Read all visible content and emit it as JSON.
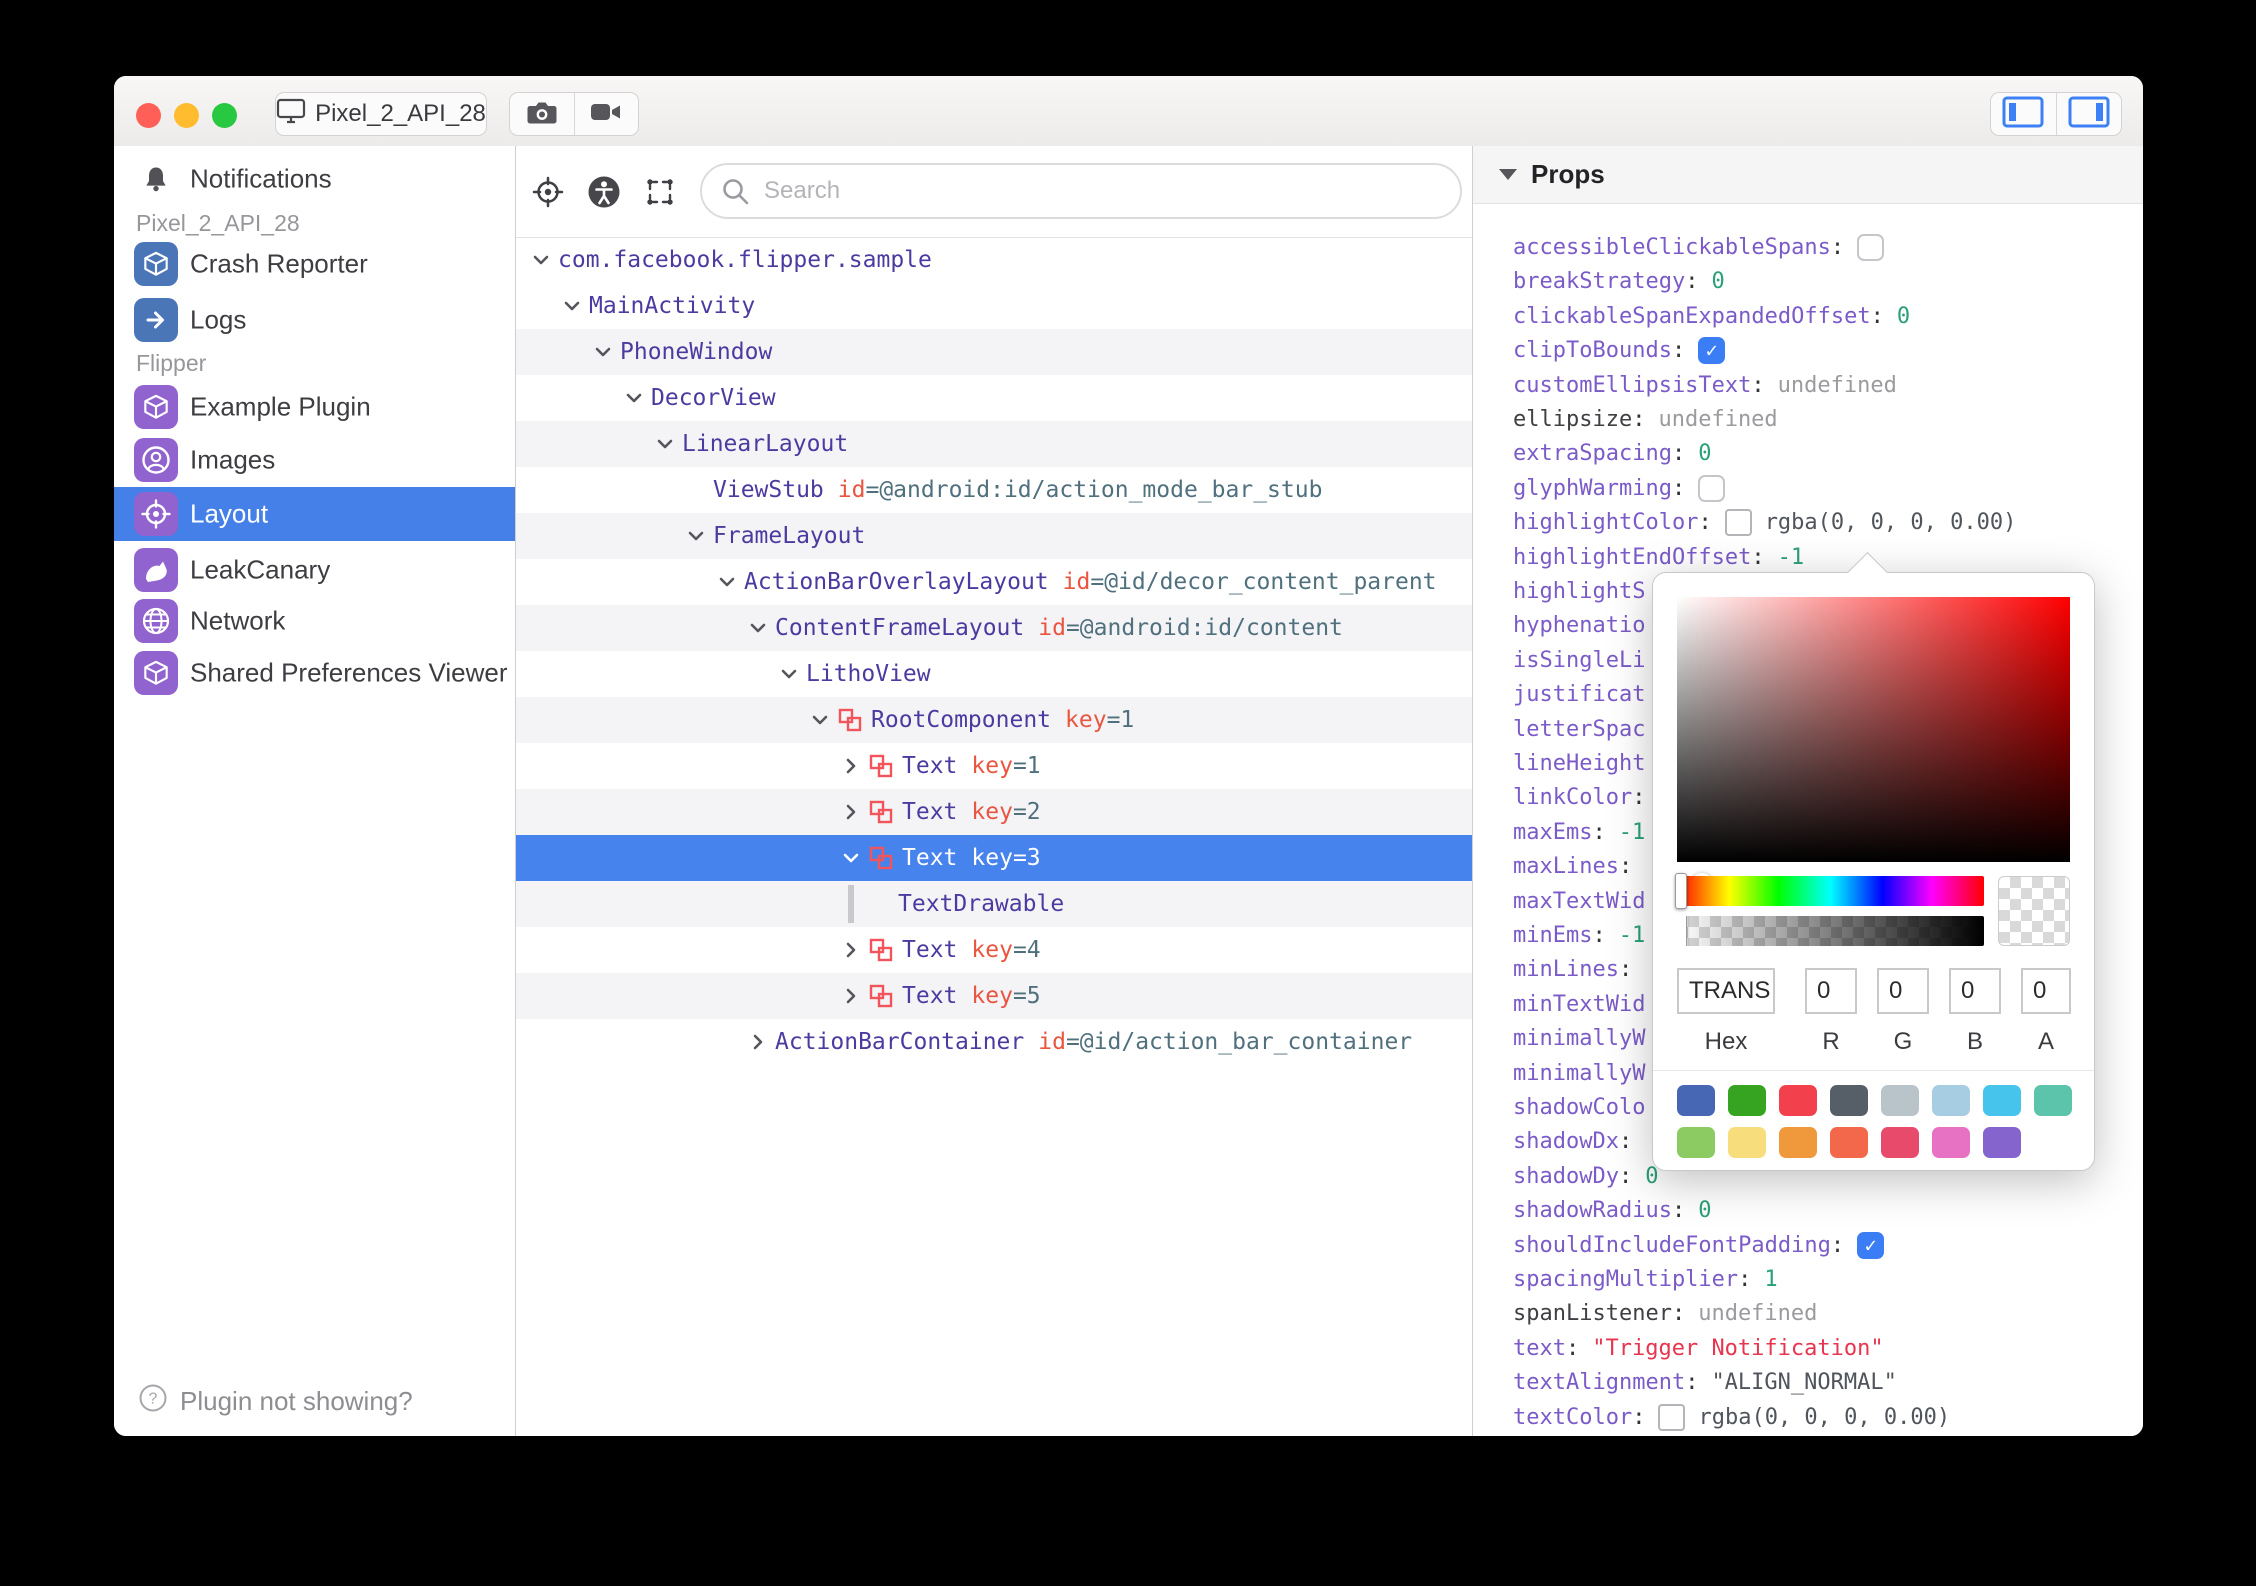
{
  "titlebar": {
    "device_button": "Pixel_2_API_28",
    "icons": [
      "close-icon",
      "minimize-icon",
      "zoom-icon",
      "monitor-icon",
      "camera-icon",
      "video-icon",
      "toggle-left-panel-icon",
      "toggle-right-panel-icon"
    ]
  },
  "sidebar": {
    "notifications_label": "Notifications",
    "device_section": "Pixel_2_API_28",
    "device_items": [
      {
        "label": "Crash Reporter",
        "icon": "cube-icon",
        "color": "#4a76b8",
        "selected": false
      },
      {
        "label": "Logs",
        "icon": "arrow-right-icon",
        "color": "#4a76b8",
        "selected": false
      }
    ],
    "flipper_section": "Flipper",
    "flipper_items": [
      {
        "label": "Example Plugin",
        "icon": "cube-icon",
        "color": "#9163cf",
        "selected": false
      },
      {
        "label": "Images",
        "icon": "user-circle-icon",
        "color": "#9163cf",
        "selected": false
      },
      {
        "label": "Layout",
        "icon": "target-icon",
        "color": "#9163cf",
        "selected": true
      },
      {
        "label": "LeakCanary",
        "icon": "bird-icon",
        "color": "#9163cf",
        "selected": false
      },
      {
        "label": "Network",
        "icon": "globe-icon",
        "color": "#9163cf",
        "selected": false
      },
      {
        "label": "Shared Preferences Viewer",
        "icon": "cube-icon",
        "color": "#9163cf",
        "selected": false
      }
    ],
    "footer": "Plugin not showing?"
  },
  "tree": {
    "search_placeholder": "Search",
    "toolbar_icons": [
      "target-icon",
      "accessibility-icon",
      "expand-selection-icon",
      "search-icon"
    ],
    "rows": [
      {
        "name": "com.facebook.flipper.sample",
        "depth": 0,
        "chevron": "down",
        "litho": false,
        "attr": null,
        "zebra": false,
        "selected": false
      },
      {
        "name": "MainActivity",
        "depth": 1,
        "chevron": "down",
        "litho": false,
        "attr": null,
        "zebra": false,
        "selected": false
      },
      {
        "name": "PhoneWindow",
        "depth": 2,
        "chevron": "down",
        "litho": false,
        "attr": null,
        "zebra": true,
        "selected": false
      },
      {
        "name": "DecorView",
        "depth": 3,
        "chevron": "down",
        "litho": false,
        "attr": null,
        "zebra": false,
        "selected": false
      },
      {
        "name": "LinearLayout",
        "depth": 4,
        "chevron": "down",
        "litho": false,
        "attr": null,
        "zebra": true,
        "selected": false
      },
      {
        "name": "ViewStub",
        "depth": 5,
        "chevron": "none",
        "litho": false,
        "attr": {
          "k": "id",
          "v": "=@android:id/action_mode_bar_stub"
        },
        "zebra": false,
        "selected": false
      },
      {
        "name": "FrameLayout",
        "depth": 5,
        "chevron": "down",
        "litho": false,
        "attr": null,
        "zebra": true,
        "selected": false
      },
      {
        "name": "ActionBarOverlayLayout",
        "depth": 6,
        "chevron": "down",
        "litho": false,
        "attr": {
          "k": "id",
          "v": "=@id/decor_content_parent"
        },
        "zebra": false,
        "selected": false
      },
      {
        "name": "ContentFrameLayout",
        "depth": 7,
        "chevron": "down",
        "litho": false,
        "attr": {
          "k": "id",
          "v": "=@android:id/content"
        },
        "zebra": true,
        "selected": false
      },
      {
        "name": "LithoView",
        "depth": 8,
        "chevron": "down",
        "litho": false,
        "attr": null,
        "zebra": false,
        "selected": false
      },
      {
        "name": "RootComponent",
        "depth": 9,
        "chevron": "down",
        "litho": true,
        "attr": {
          "k": "key",
          "v": "=1"
        },
        "zebra": true,
        "selected": false
      },
      {
        "name": "Text",
        "depth": 10,
        "chevron": "right",
        "litho": true,
        "attr": {
          "k": "key",
          "v": "=1"
        },
        "zebra": false,
        "selected": false
      },
      {
        "name": "Text",
        "depth": 10,
        "chevron": "right",
        "litho": true,
        "attr": {
          "k": "key",
          "v": "=2"
        },
        "zebra": true,
        "selected": false
      },
      {
        "name": "Text",
        "depth": 10,
        "chevron": "down",
        "litho": true,
        "attr": {
          "k": "key",
          "v": "=3"
        },
        "zebra": false,
        "selected": true
      },
      {
        "name": "TextDrawable",
        "depth": 11,
        "chevron": "bar",
        "litho": false,
        "attr": null,
        "zebra": true,
        "selected": false
      },
      {
        "name": "Text",
        "depth": 10,
        "chevron": "right",
        "litho": true,
        "attr": {
          "k": "key",
          "v": "=4"
        },
        "zebra": false,
        "selected": false
      },
      {
        "name": "Text",
        "depth": 10,
        "chevron": "right",
        "litho": true,
        "attr": {
          "k": "key",
          "v": "=5"
        },
        "zebra": true,
        "selected": false
      },
      {
        "name": "ActionBarContainer",
        "depth": 7,
        "chevron": "right",
        "litho": false,
        "attr": {
          "k": "id",
          "v": "=@id/action_bar_container"
        },
        "zebra": false,
        "selected": false
      }
    ]
  },
  "props": {
    "title": "Props",
    "rows": [
      {
        "key": "accessibleClickableSpans",
        "key_style": "purple",
        "colon": true,
        "value": null,
        "value_style": null,
        "control": "check-off"
      },
      {
        "key": "breakStrategy",
        "key_style": "purple",
        "colon": true,
        "value": "0",
        "value_style": "number",
        "control": null
      },
      {
        "key": "clickableSpanExpandedOffset",
        "key_style": "purple",
        "colon": true,
        "value": "0",
        "value_style": "number",
        "control": null
      },
      {
        "key": "clipToBounds",
        "key_style": "purple",
        "colon": true,
        "value": null,
        "value_style": null,
        "control": "check-on"
      },
      {
        "key": "customEllipsisText",
        "key_style": "purple",
        "colon": true,
        "value": "undefined",
        "value_style": "undef",
        "control": null
      },
      {
        "key": "ellipsize",
        "key_style": "dark",
        "colon": true,
        "value": "undefined",
        "value_style": "undef",
        "control": null
      },
      {
        "key": "extraSpacing",
        "key_style": "purple",
        "colon": true,
        "value": "0",
        "value_style": "number",
        "control": null
      },
      {
        "key": "glyphWarming",
        "key_style": "purple",
        "colon": true,
        "value": null,
        "value_style": null,
        "control": "check-off"
      },
      {
        "key": "highlightColor",
        "key_style": "purple",
        "colon": true,
        "value": "rgba(0, 0, 0, 0.00)",
        "value_style": "dark",
        "control": "swatch"
      },
      {
        "key": "highlightEndOffset",
        "key_style": "purple",
        "colon": true,
        "value": "-1",
        "value_style": "number",
        "control": null
      },
      {
        "key": "highlightS",
        "key_style": "purple",
        "colon": false,
        "value": null,
        "value_style": null,
        "control": null
      },
      {
        "key": "hyphenatio",
        "key_style": "purple",
        "colon": false,
        "value": null,
        "value_style": null,
        "control": null
      },
      {
        "key": "isSingleLi",
        "key_style": "purple",
        "colon": false,
        "value": null,
        "value_style": null,
        "control": null
      },
      {
        "key": "justificat",
        "key_style": "purple",
        "colon": false,
        "value": null,
        "value_style": null,
        "control": null
      },
      {
        "key": "letterSpac",
        "key_style": "purple",
        "colon": false,
        "value": null,
        "value_style": null,
        "control": null
      },
      {
        "key": "lineHeight",
        "key_style": "purple",
        "colon": false,
        "value": null,
        "value_style": null,
        "control": null
      },
      {
        "key": "linkColor",
        "key_style": "purple",
        "colon": true,
        "value": null,
        "value_style": null,
        "control": null
      },
      {
        "key": "maxEms",
        "key_style": "purple",
        "colon": true,
        "value": "-1",
        "value_style": "number",
        "control": null
      },
      {
        "key": "maxLines",
        "key_style": "purple",
        "colon": true,
        "value": null,
        "value_style": null,
        "control": null
      },
      {
        "key": "maxTextWid",
        "key_style": "purple",
        "colon": false,
        "value": null,
        "value_style": null,
        "control": null
      },
      {
        "key": "minEms",
        "key_style": "purple",
        "colon": true,
        "value": "-1",
        "value_style": "number",
        "control": null
      },
      {
        "key": "minLines",
        "key_style": "purple",
        "colon": true,
        "value": null,
        "value_style": null,
        "control": null
      },
      {
        "key": "minTextWid",
        "key_style": "purple",
        "colon": false,
        "value": null,
        "value_style": null,
        "control": null
      },
      {
        "key": "minimallyW",
        "key_style": "purple",
        "colon": false,
        "value": null,
        "value_style": null,
        "control": null
      },
      {
        "key": "minimallyW",
        "key_style": "purple",
        "colon": false,
        "value": null,
        "value_style": null,
        "control": null
      },
      {
        "key": "shadowColo",
        "key_style": "purple",
        "colon": false,
        "value": null,
        "value_style": null,
        "control": null
      },
      {
        "key": "shadowDx",
        "key_style": "purple",
        "colon": true,
        "value": null,
        "value_style": null,
        "control": null
      },
      {
        "key": "shadowDy",
        "key_style": "purple",
        "colon": true,
        "value": "0",
        "value_style": "number",
        "control": null
      },
      {
        "key": "shadowRadius",
        "key_style": "purple",
        "colon": true,
        "value": "0",
        "value_style": "number",
        "control": null
      },
      {
        "key": "shouldIncludeFontPadding",
        "key_style": "purple",
        "colon": true,
        "value": null,
        "value_style": null,
        "control": "check-on"
      },
      {
        "key": "spacingMultiplier",
        "key_style": "purple",
        "colon": true,
        "value": "1",
        "value_style": "number",
        "control": null
      },
      {
        "key": "spanListener",
        "key_style": "dark",
        "colon": true,
        "value": "undefined",
        "value_style": "undef",
        "control": null
      },
      {
        "key": "text",
        "key_style": "purple",
        "colon": true,
        "value": "\"Trigger Notification\"",
        "value_style": "string",
        "control": null
      },
      {
        "key": "textAlignment",
        "key_style": "purple",
        "colon": true,
        "value": "\"ALIGN_NORMAL\"",
        "value_style": "dark",
        "control": null
      },
      {
        "key": "textColor",
        "key_style": "purple",
        "colon": true,
        "value": "rgba(0, 0, 0, 0.00)",
        "value_style": "dark",
        "control": "swatch"
      }
    ]
  },
  "picker": {
    "hex": "TRANS",
    "r": "0",
    "g": "0",
    "b": "0",
    "a": "0",
    "labels": [
      "Hex",
      "R",
      "G",
      "B",
      "A"
    ],
    "palette_row1": [
      "#4766b4",
      "#36a420",
      "#f2404c",
      "#565e68",
      "#b8c4ca",
      "#a6cde2",
      "#46c4ec",
      "#5cc4aa"
    ],
    "palette_row2": [
      "#8cca62",
      "#f7dd7c",
      "#f0993c",
      "#f3684a",
      "#e84a6b",
      "#e772c3",
      "#8564ce"
    ]
  },
  "colors": {
    "selection_blue": "#4783ec",
    "sidebar_selection_blue": "#4580e8",
    "plugin_purple": "#9163cf",
    "device_plugin_blue": "#4a76b8",
    "litho_pink": "#f2545b",
    "tree_name_purple": "#4d3aa0",
    "attr_orange": "#ea5540",
    "attr_value_slate": "#50707e",
    "prop_key_purple": "#7b5bc8",
    "number_teal": "#2aa07a",
    "string_red": "#e8354f",
    "checkbox_blue": "#3b7df5",
    "traffic_red": "#ff5f57",
    "traffic_yellow": "#febc2e",
    "traffic_green": "#28c840"
  }
}
